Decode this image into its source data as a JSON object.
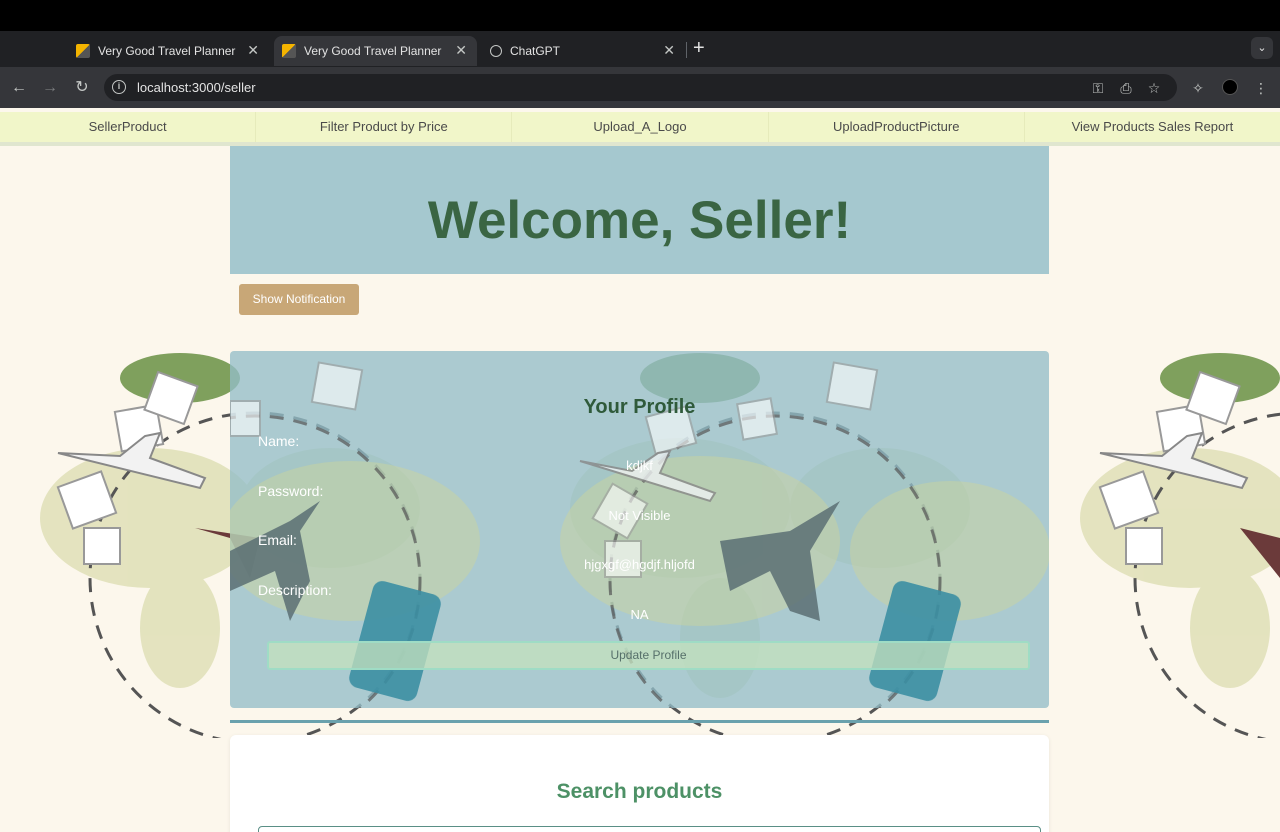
{
  "browser": {
    "tabs": [
      {
        "title": "Very Good Travel Planner",
        "active": false,
        "favicon": "travel-icon"
      },
      {
        "title": "Very Good Travel Planner",
        "active": true,
        "favicon": "travel-icon"
      },
      {
        "title": "ChatGPT",
        "active": false,
        "favicon": "openai-icon"
      }
    ],
    "url": "localhost:3000/seller"
  },
  "nav": {
    "items": [
      "SellerProduct",
      "Filter Product by Price",
      "Upload_A_Logo",
      "UploadProductPicture",
      "View Products Sales Report"
    ]
  },
  "hero": {
    "title": "Welcome, Seller!"
  },
  "notification": {
    "button_label": "Show Notification"
  },
  "profile": {
    "title": "Your Profile",
    "fields": [
      {
        "label": "Name:",
        "value": "kdjkf"
      },
      {
        "label": "Password:",
        "value": "Not Visible"
      },
      {
        "label": "Email:",
        "value": "hjgxgf@hgdjf.hljofd"
      },
      {
        "label": "Description:",
        "value": "NA"
      }
    ],
    "update_label": "Update Profile"
  },
  "search": {
    "title": "Search products"
  },
  "colors": {
    "page_bg": "#fcf7ec",
    "nav_bg": "#f1f6c9",
    "hero_bg": "#a5c8cf",
    "hero_text": "#3a6543",
    "notify_btn": "#c8a777",
    "search_title": "#4d9166"
  }
}
